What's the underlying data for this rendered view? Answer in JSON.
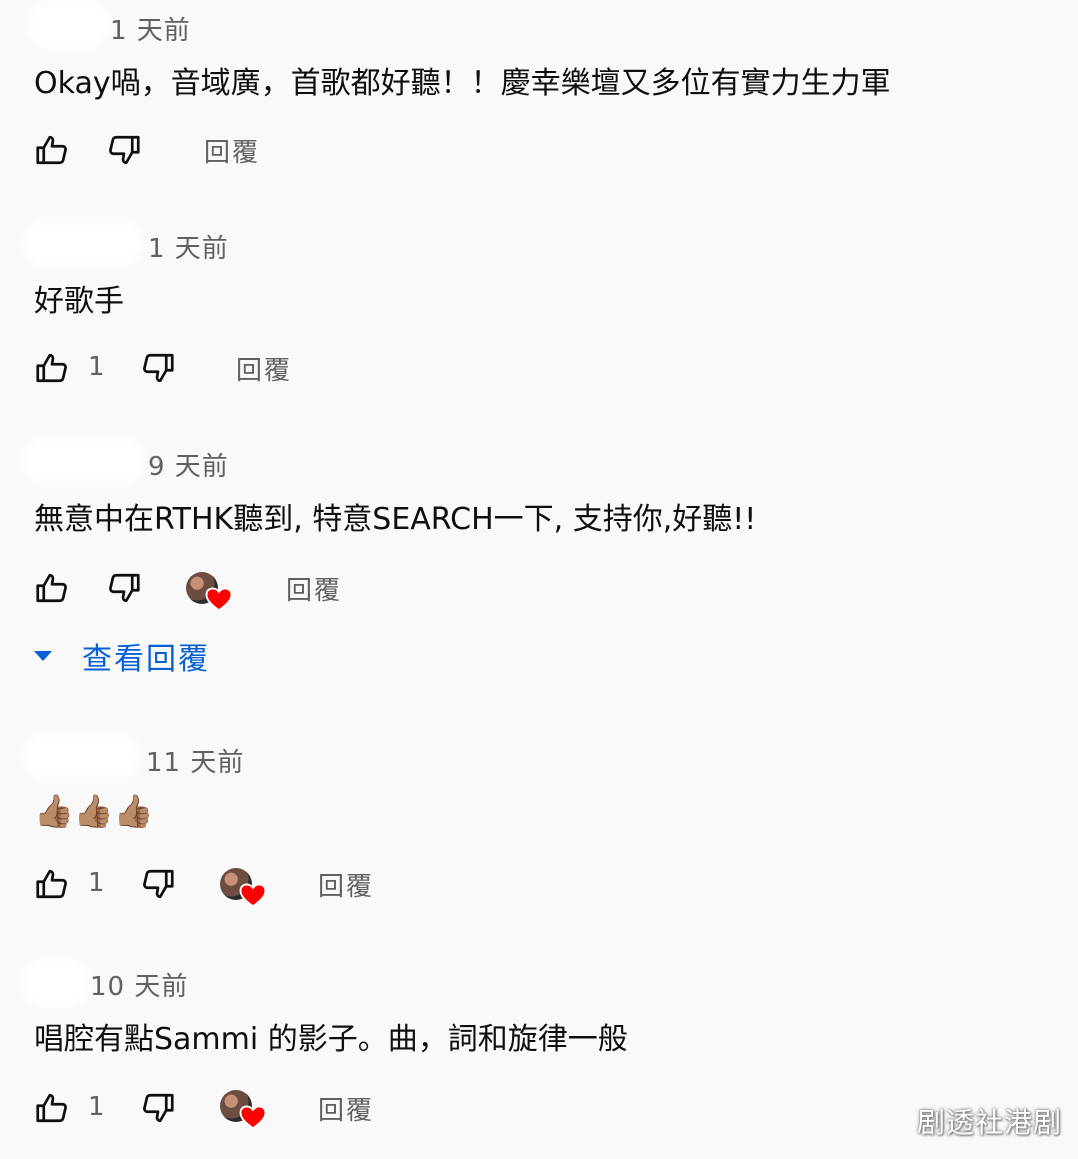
{
  "comments": [
    {
      "time": "1 天前",
      "text": "Okay喎，音域廣，首歌都好聽！！慶幸樂壇又多位有實力生力軍",
      "likes": "",
      "reply_label": "回覆",
      "hearted": false
    },
    {
      "time": "1 天前",
      "text": "好歌手",
      "likes": "1",
      "reply_label": "回覆",
      "hearted": false
    },
    {
      "time": "9 天前",
      "text": "無意中在RTHK聽到, 特意SEARCH一下, 支持你,好聽!!",
      "likes": "",
      "reply_label": "回覆",
      "hearted": true,
      "view_replies_label": "查看回覆"
    },
    {
      "time": "11 天前",
      "text": "👍🏽👍🏽👍🏽",
      "likes": "1",
      "reply_label": "回覆",
      "hearted": true
    },
    {
      "time": "10 天前",
      "text": "唱腔有點Sammi 的影子。曲，詞和旋律一般",
      "likes": "1",
      "reply_label": "回覆",
      "hearted": true
    }
  ],
  "watermark": "剧透社港剧",
  "icons": {
    "like": "thumb-up-icon",
    "dislike": "thumb-down-icon",
    "expand": "caret-down-icon",
    "heart": "heart-icon"
  },
  "colors": {
    "link": "#065fd4",
    "heart": "#ff0000",
    "meta": "#606060"
  }
}
